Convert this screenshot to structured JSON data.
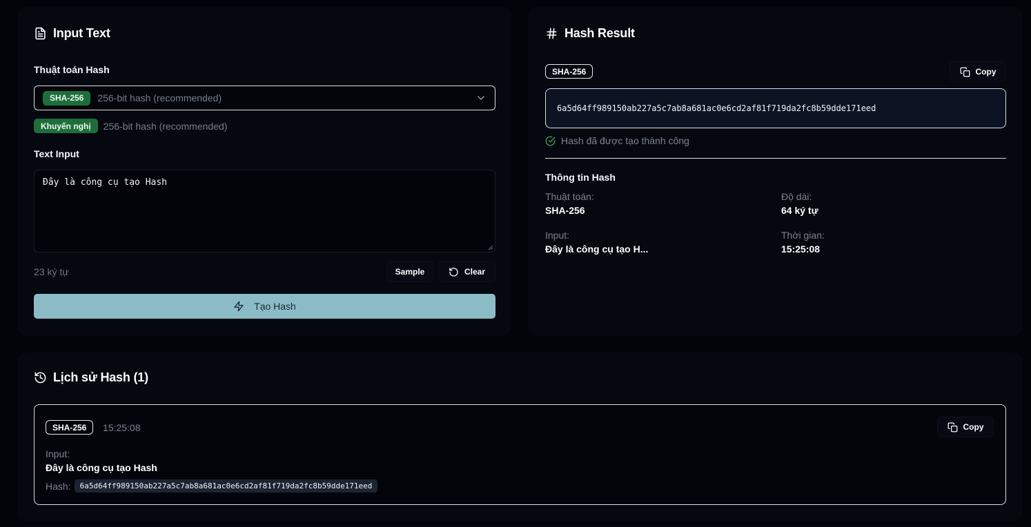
{
  "input_card": {
    "title": "Input Text",
    "algorithm_label": "Thuật toán Hash",
    "selected_algorithm": "SHA-256",
    "selected_description": "256-bit hash (recommended)",
    "recommend_badge": "Khuyến nghị",
    "recommend_description": "256-bit hash (recommended)",
    "text_input_label": "Text Input",
    "text_value": "Đây là công cụ tạo Hash",
    "char_count": "23 ký tự",
    "sample_button": "Sample",
    "clear_button": "Clear",
    "generate_button": "Tạo Hash"
  },
  "result_card": {
    "title": "Hash Result",
    "algorithm_badge": "SHA-256",
    "copy_button": "Copy",
    "hash_value": "6a5d64ff989150ab227a5c7ab8a681ac0e6cd2af81f719da2fc8b59dde171eed",
    "success_message": "Hash đã được tạo thành công",
    "info_title": "Thông tin Hash",
    "info": {
      "algorithm_label": "Thuật toán:",
      "algorithm_value": "SHA-256",
      "length_label": "Độ dài:",
      "length_value": "64 ký tự",
      "input_label": "Input:",
      "input_value": "Đây là công cụ tạo H...",
      "time_label": "Thời gian:",
      "time_value": "15:25:08"
    }
  },
  "history_card": {
    "title": "Lịch sử Hash (1)",
    "items": [
      {
        "algorithm": "SHA-256",
        "time": "15:25:08",
        "copy_button": "Copy",
        "input_label": "Input:",
        "input_value": "Đây là công cụ tạo Hash",
        "hash_label": "Hash:",
        "hash_value": "6a5d64ff989150ab227a5c7ab8a681ac0e6cd2af81f719da2fc8b59dde171eed"
      }
    ]
  },
  "colors": {
    "background": "#02040a",
    "card": "#05080f",
    "badge_green": "#1e6e3c",
    "primary_button": "#8bbcc6",
    "success_icon": "#3fa860"
  },
  "icons": {
    "input_title": "file-text-icon",
    "result_title": "hash-icon",
    "history_title": "history-icon",
    "select": "chevron-down-icon",
    "clear": "rotate-ccw-icon",
    "generate": "zap-icon",
    "copy": "copy-icon",
    "success": "check-circle-icon"
  }
}
